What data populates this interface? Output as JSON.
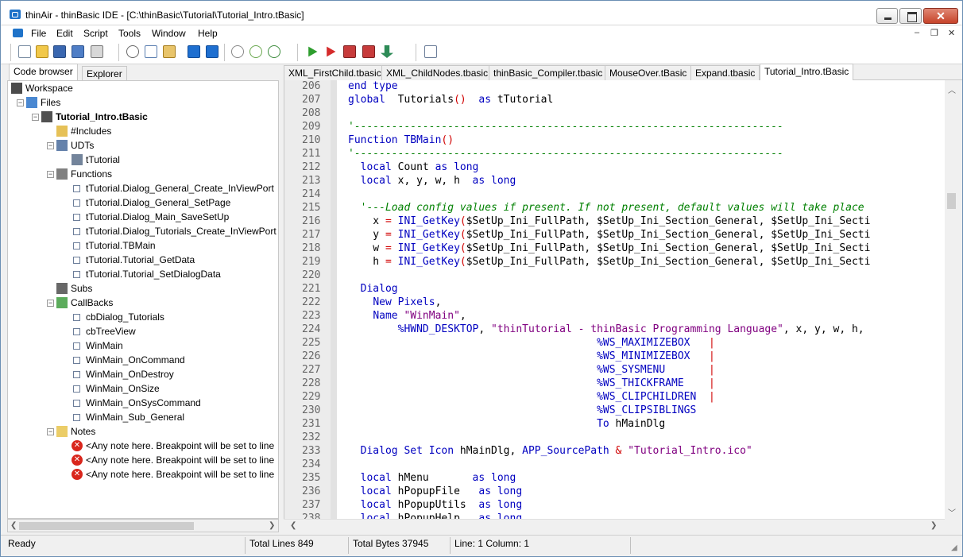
{
  "window": {
    "title": "thinAir - thinBasic IDE - [C:\\thinBasic\\Tutorial\\Tutorial_Intro.tBasic]",
    "close_glyph": "✕"
  },
  "menu": [
    "File",
    "Edit",
    "Script",
    "Tools",
    "Window",
    "Help"
  ],
  "toolbar_icons": [
    "new-file-icon",
    "open-file-icon",
    "save-icon",
    "save-all-icon",
    "print-icon",
    "cut-icon",
    "copy-icon",
    "paste-icon",
    "undo-icon",
    "redo-icon",
    "find-icon",
    "find-next-icon",
    "replace-icon",
    "run-icon",
    "run-debug-icon",
    "build-icon",
    "build-options-icon",
    "step-icon",
    "properties-icon"
  ],
  "left_tabs": [
    "Code browser",
    "Explorer"
  ],
  "tree": [
    {
      "label": "Workspace",
      "level": 0,
      "icon": "workspace-icon",
      "bold": false,
      "exp": ""
    },
    {
      "label": "Files",
      "level": 1,
      "icon": "files-icon",
      "bold": false,
      "exp": "-"
    },
    {
      "label": "Tutorial_Intro.tBasic",
      "level": 2,
      "icon": "document-icon",
      "bold": true,
      "exp": "-"
    },
    {
      "label": "#Includes",
      "level": 3,
      "icon": "includes-icon",
      "bold": false,
      "exp": ""
    },
    {
      "label": "UDTs",
      "level": 3,
      "icon": "udt-icon",
      "bold": false,
      "exp": "-"
    },
    {
      "label": "tTutorial",
      "level": 4,
      "icon": "type-icon",
      "bold": false,
      "exp": ""
    },
    {
      "label": "Functions",
      "level": 3,
      "icon": "functions-icon",
      "bold": false,
      "exp": "-"
    },
    {
      "label": "tTutorial.Dialog_General_Create_InViewPort",
      "level": 4,
      "icon": "function-icon",
      "bold": false,
      "exp": ""
    },
    {
      "label": "tTutorial.Dialog_General_SetPage",
      "level": 4,
      "icon": "function-icon",
      "bold": false,
      "exp": ""
    },
    {
      "label": "tTutorial.Dialog_Main_SaveSetUp",
      "level": 4,
      "icon": "function-icon",
      "bold": false,
      "exp": ""
    },
    {
      "label": "tTutorial.Dialog_Tutorials_Create_InViewPort",
      "level": 4,
      "icon": "function-icon",
      "bold": false,
      "exp": ""
    },
    {
      "label": "tTutorial.TBMain",
      "level": 4,
      "icon": "function-icon",
      "bold": false,
      "exp": ""
    },
    {
      "label": "tTutorial.Tutorial_GetData",
      "level": 4,
      "icon": "function-icon",
      "bold": false,
      "exp": ""
    },
    {
      "label": "tTutorial.Tutorial_SetDialogData",
      "level": 4,
      "icon": "function-icon",
      "bold": false,
      "exp": ""
    },
    {
      "label": "Subs",
      "level": 3,
      "icon": "subs-icon",
      "bold": false,
      "exp": ""
    },
    {
      "label": "CallBacks",
      "level": 3,
      "icon": "callbacks-icon",
      "bold": false,
      "exp": "-"
    },
    {
      "label": "cbDialog_Tutorials",
      "level": 4,
      "icon": "function-icon",
      "bold": false,
      "exp": ""
    },
    {
      "label": "cbTreeView",
      "level": 4,
      "icon": "function-icon",
      "bold": false,
      "exp": ""
    },
    {
      "label": "WinMain",
      "level": 4,
      "icon": "function-icon",
      "bold": false,
      "exp": ""
    },
    {
      "label": "WinMain_OnCommand",
      "level": 4,
      "icon": "function-icon",
      "bold": false,
      "exp": ""
    },
    {
      "label": "WinMain_OnDestroy",
      "level": 4,
      "icon": "function-icon",
      "bold": false,
      "exp": ""
    },
    {
      "label": "WinMain_OnSize",
      "level": 4,
      "icon": "function-icon",
      "bold": false,
      "exp": ""
    },
    {
      "label": "WinMain_OnSysCommand",
      "level": 4,
      "icon": "function-icon",
      "bold": false,
      "exp": ""
    },
    {
      "label": "WinMain_Sub_General",
      "level": 4,
      "icon": "function-icon",
      "bold": false,
      "exp": ""
    },
    {
      "label": "Notes",
      "level": 3,
      "icon": "notes-icon",
      "bold": false,
      "exp": "-"
    },
    {
      "label": "<Any note here. Breakpoint will be set to line",
      "level": 4,
      "icon": "error-icon",
      "bold": false,
      "exp": ""
    },
    {
      "label": "<Any note here. Breakpoint will be set to line",
      "level": 4,
      "icon": "error-icon",
      "bold": false,
      "exp": ""
    },
    {
      "label": "<Any note here. Breakpoint will be set to line",
      "level": 4,
      "icon": "error-icon",
      "bold": false,
      "exp": ""
    }
  ],
  "editor_tabs": [
    "XML_FirstChild.tbasic",
    "XML_ChildNodes.tbasic",
    "thinBasic_Compiler.tbasic",
    "MouseOver.tBasic",
    "Expand.tbasic",
    "Tutorial_Intro.tBasic"
  ],
  "active_tab": "Tutorial_Intro.tBasic",
  "code": [
    {
      "n": "206",
      "t": [
        [
          "k",
          "end type"
        ]
      ]
    },
    {
      "n": "207",
      "t": [
        [
          "k",
          "global"
        ],
        [
          "",
          "  Tutorials"
        ],
        [
          "r",
          "()"
        ],
        [
          "",
          "  "
        ],
        [
          "k",
          "as"
        ],
        [
          "",
          " tTutorial"
        ]
      ]
    },
    {
      "n": "208",
      "t": []
    },
    {
      "n": "209",
      "t": [
        [
          "c",
          "'---------------------------------------------------------------------"
        ]
      ]
    },
    {
      "n": "210",
      "t": [
        [
          "k",
          "Function TBMain"
        ],
        [
          "r",
          "()"
        ]
      ]
    },
    {
      "n": "211",
      "t": [
        [
          "c",
          "'---------------------------------------------------------------------"
        ]
      ]
    },
    {
      "n": "212",
      "t": [
        [
          "",
          "  "
        ],
        [
          "k",
          "local"
        ],
        [
          "",
          " Count "
        ],
        [
          "k",
          "as long"
        ]
      ]
    },
    {
      "n": "213",
      "t": [
        [
          "",
          "  "
        ],
        [
          "k",
          "local"
        ],
        [
          "",
          " x, y, w, h  "
        ],
        [
          "k",
          "as long"
        ]
      ]
    },
    {
      "n": "214",
      "t": []
    },
    {
      "n": "215",
      "t": [
        [
          "c",
          "  '---Load config values if present. If not present, default values will take place"
        ]
      ]
    },
    {
      "n": "216",
      "t": [
        [
          "",
          "    x "
        ],
        [
          "r",
          "="
        ],
        [
          " k",
          " INI_GetKey"
        ],
        [
          "r",
          "("
        ],
        [
          "",
          "$SetUp_Ini_FullPath, $SetUp_Ini_Section_General, $SetUp_Ini_Secti"
        ]
      ]
    },
    {
      "n": "217",
      "t": [
        [
          "",
          "    y "
        ],
        [
          "r",
          "="
        ],
        [
          " k",
          " INI_GetKey"
        ],
        [
          "r",
          "("
        ],
        [
          "",
          "$SetUp_Ini_FullPath, $SetUp_Ini_Section_General, $SetUp_Ini_Secti"
        ]
      ]
    },
    {
      "n": "218",
      "t": [
        [
          "",
          "    w "
        ],
        [
          "r",
          "="
        ],
        [
          " k",
          " INI_GetKey"
        ],
        [
          "r",
          "("
        ],
        [
          "",
          "$SetUp_Ini_FullPath, $SetUp_Ini_Section_General, $SetUp_Ini_Secti"
        ]
      ]
    },
    {
      "n": "219",
      "t": [
        [
          "",
          "    h "
        ],
        [
          "r",
          "="
        ],
        [
          " k",
          " INI_GetKey"
        ],
        [
          "r",
          "("
        ],
        [
          "",
          "$SetUp_Ini_FullPath, $SetUp_Ini_Section_General, $SetUp_Ini_Secti"
        ]
      ]
    },
    {
      "n": "220",
      "t": []
    },
    {
      "n": "221",
      "t": [
        [
          "",
          "  "
        ],
        [
          "k",
          "Dialog"
        ]
      ]
    },
    {
      "n": "222",
      "t": [
        [
          "",
          "    "
        ],
        [
          "k",
          "New Pixels"
        ],
        [
          "",
          ","
        ]
      ]
    },
    {
      "n": "223",
      "t": [
        [
          "",
          "    "
        ],
        [
          "k",
          "Name"
        ],
        [
          "s",
          " \"WinMain\""
        ],
        [
          "",
          ","
        ]
      ]
    },
    {
      "n": "224",
      "t": [
        [
          "",
          "        "
        ],
        [
          "k",
          "%HWND_DESKTOP"
        ],
        [
          "",
          ", "
        ],
        [
          "s",
          "\"thinTutorial - thinBasic Programming Language\""
        ],
        [
          "",
          ", x, y, w, h,"
        ]
      ]
    },
    {
      "n": "225",
      "t": [
        [
          "",
          "                                        "
        ],
        [
          "k",
          "%WS_MAXIMIZEBOX"
        ],
        [
          "",
          "   "
        ],
        [
          "r",
          "|"
        ]
      ]
    },
    {
      "n": "226",
      "t": [
        [
          "",
          "                                        "
        ],
        [
          "k",
          "%WS_MINIMIZEBOX"
        ],
        [
          "",
          "   "
        ],
        [
          "r",
          "|"
        ]
      ]
    },
    {
      "n": "227",
      "t": [
        [
          "",
          "                                        "
        ],
        [
          "k",
          "%WS_SYSMENU"
        ],
        [
          "",
          "       "
        ],
        [
          "r",
          "|"
        ]
      ]
    },
    {
      "n": "228",
      "t": [
        [
          "",
          "                                        "
        ],
        [
          "k",
          "%WS_THICKFRAME"
        ],
        [
          "",
          "    "
        ],
        [
          "r",
          "|"
        ]
      ]
    },
    {
      "n": "229",
      "t": [
        [
          "",
          "                                        "
        ],
        [
          "k",
          "%WS_CLIPCHILDREN"
        ],
        [
          "",
          "  "
        ],
        [
          "r",
          "|"
        ]
      ]
    },
    {
      "n": "230",
      "t": [
        [
          "",
          "                                        "
        ],
        [
          "k",
          "%WS_CLIPSIBLINGS"
        ]
      ]
    },
    {
      "n": "231",
      "t": [
        [
          "",
          "                                        "
        ],
        [
          "k",
          "To"
        ],
        [
          "",
          " hMainDlg"
        ]
      ]
    },
    {
      "n": "232",
      "t": []
    },
    {
      "n": "233",
      "t": [
        [
          "",
          "  "
        ],
        [
          "k",
          "Dialog Set Icon"
        ],
        [
          "",
          " hMainDlg, "
        ],
        [
          "k",
          "APP_SourcePath"
        ],
        [
          "r",
          " &"
        ],
        [
          "s",
          " \"Tutorial_Intro.ico\""
        ]
      ]
    },
    {
      "n": "234",
      "t": []
    },
    {
      "n": "235",
      "t": [
        [
          "",
          "  "
        ],
        [
          "k",
          "local"
        ],
        [
          "",
          " hMenu       "
        ],
        [
          "k",
          "as long"
        ]
      ]
    },
    {
      "n": "236",
      "t": [
        [
          "",
          "  "
        ],
        [
          "k",
          "local"
        ],
        [
          "",
          " hPopupFile   "
        ],
        [
          "k",
          "as long"
        ]
      ]
    },
    {
      "n": "237",
      "t": [
        [
          "",
          "  "
        ],
        [
          "k",
          "local"
        ],
        [
          "",
          " hPopupUtils  "
        ],
        [
          "k",
          "as long"
        ]
      ]
    },
    {
      "n": "238",
      "t": [
        [
          "",
          "  "
        ],
        [
          "k",
          "local"
        ],
        [
          "",
          " hPopupHelp   "
        ],
        [
          "k",
          "as long"
        ]
      ]
    }
  ],
  "status": {
    "state": "Ready",
    "total_lines": "Total Lines 849",
    "total_bytes": "Total Bytes 37945",
    "position": "Line: 1 Column: 1"
  }
}
